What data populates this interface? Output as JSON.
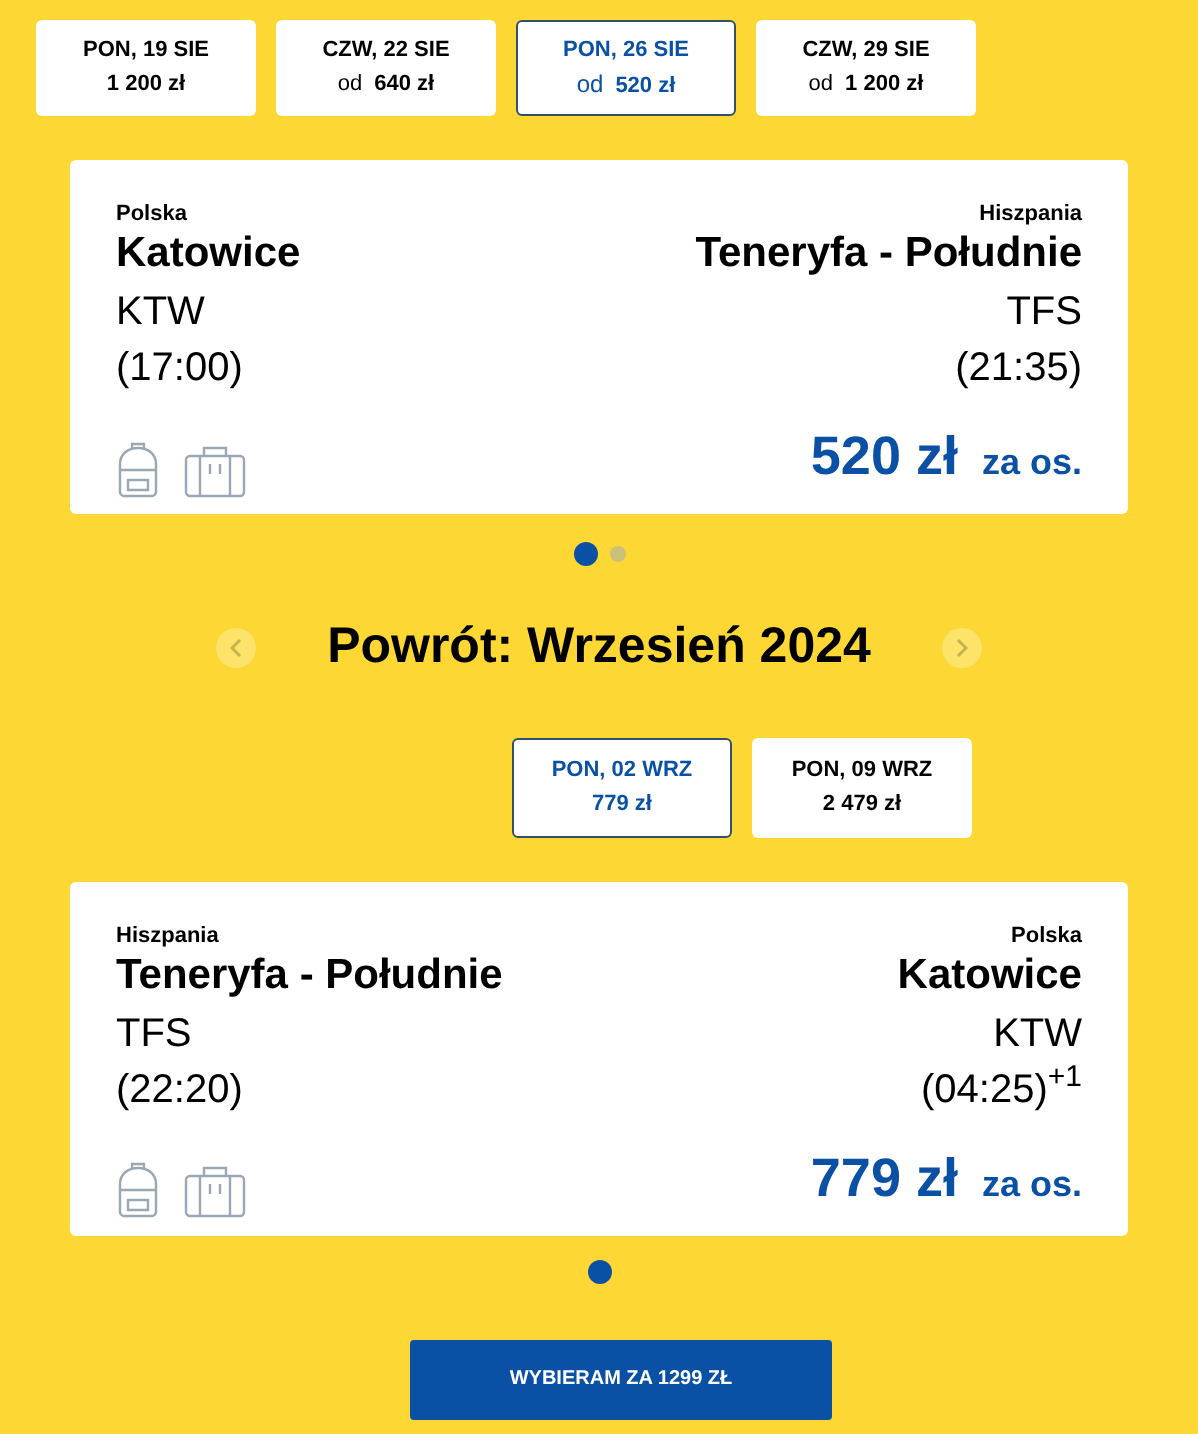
{
  "outbound_dates": [
    {
      "day": "PON, 19 SIE",
      "price": "1 200 zł",
      "selected": false
    },
    {
      "day": "CZW, 22 SIE",
      "prefix": "od",
      "price": "640 zł",
      "selected": false
    },
    {
      "day": "PON, 26 SIE",
      "prefix": "od",
      "price": "520 zł",
      "selected": true
    },
    {
      "day": "CZW, 29 SIE",
      "prefix": "od",
      "price": "1 200 zł",
      "selected": false
    }
  ],
  "outbound_flight": {
    "from": {
      "country": "Polska",
      "city": "Katowice",
      "code": "KTW",
      "time": "(17:00)"
    },
    "to": {
      "country": "Hiszpania",
      "city": "Teneryfa - Południe",
      "code": "TFS",
      "time": "(21:35)"
    },
    "price": "520 zł",
    "per_person": "za os."
  },
  "outbound_dots": [
    {
      "selected": true
    },
    {
      "selected": false
    }
  ],
  "return_heading": "Powrót: Wrzesień 2024",
  "return_dates": [
    {
      "day": "PON, 02 WRZ",
      "price": "779 zł",
      "selected": true
    },
    {
      "day": "PON, 09 WRZ",
      "price": "2 479 zł",
      "selected": false
    }
  ],
  "return_flight": {
    "from": {
      "country": "Hiszpania",
      "city": "Teneryfa - Południe",
      "code": "TFS",
      "time": "(22:20)"
    },
    "to": {
      "country": "Polska",
      "city": "Katowice",
      "code": "KTW",
      "time": "(04:25)$^{+1}$"
    },
    "price": "779 zł",
    "per_person": "za os."
  },
  "return_dots": [
    {
      "selected": true
    }
  ],
  "select_button": "WYBIERAM ZA 1299 ZŁ"
}
